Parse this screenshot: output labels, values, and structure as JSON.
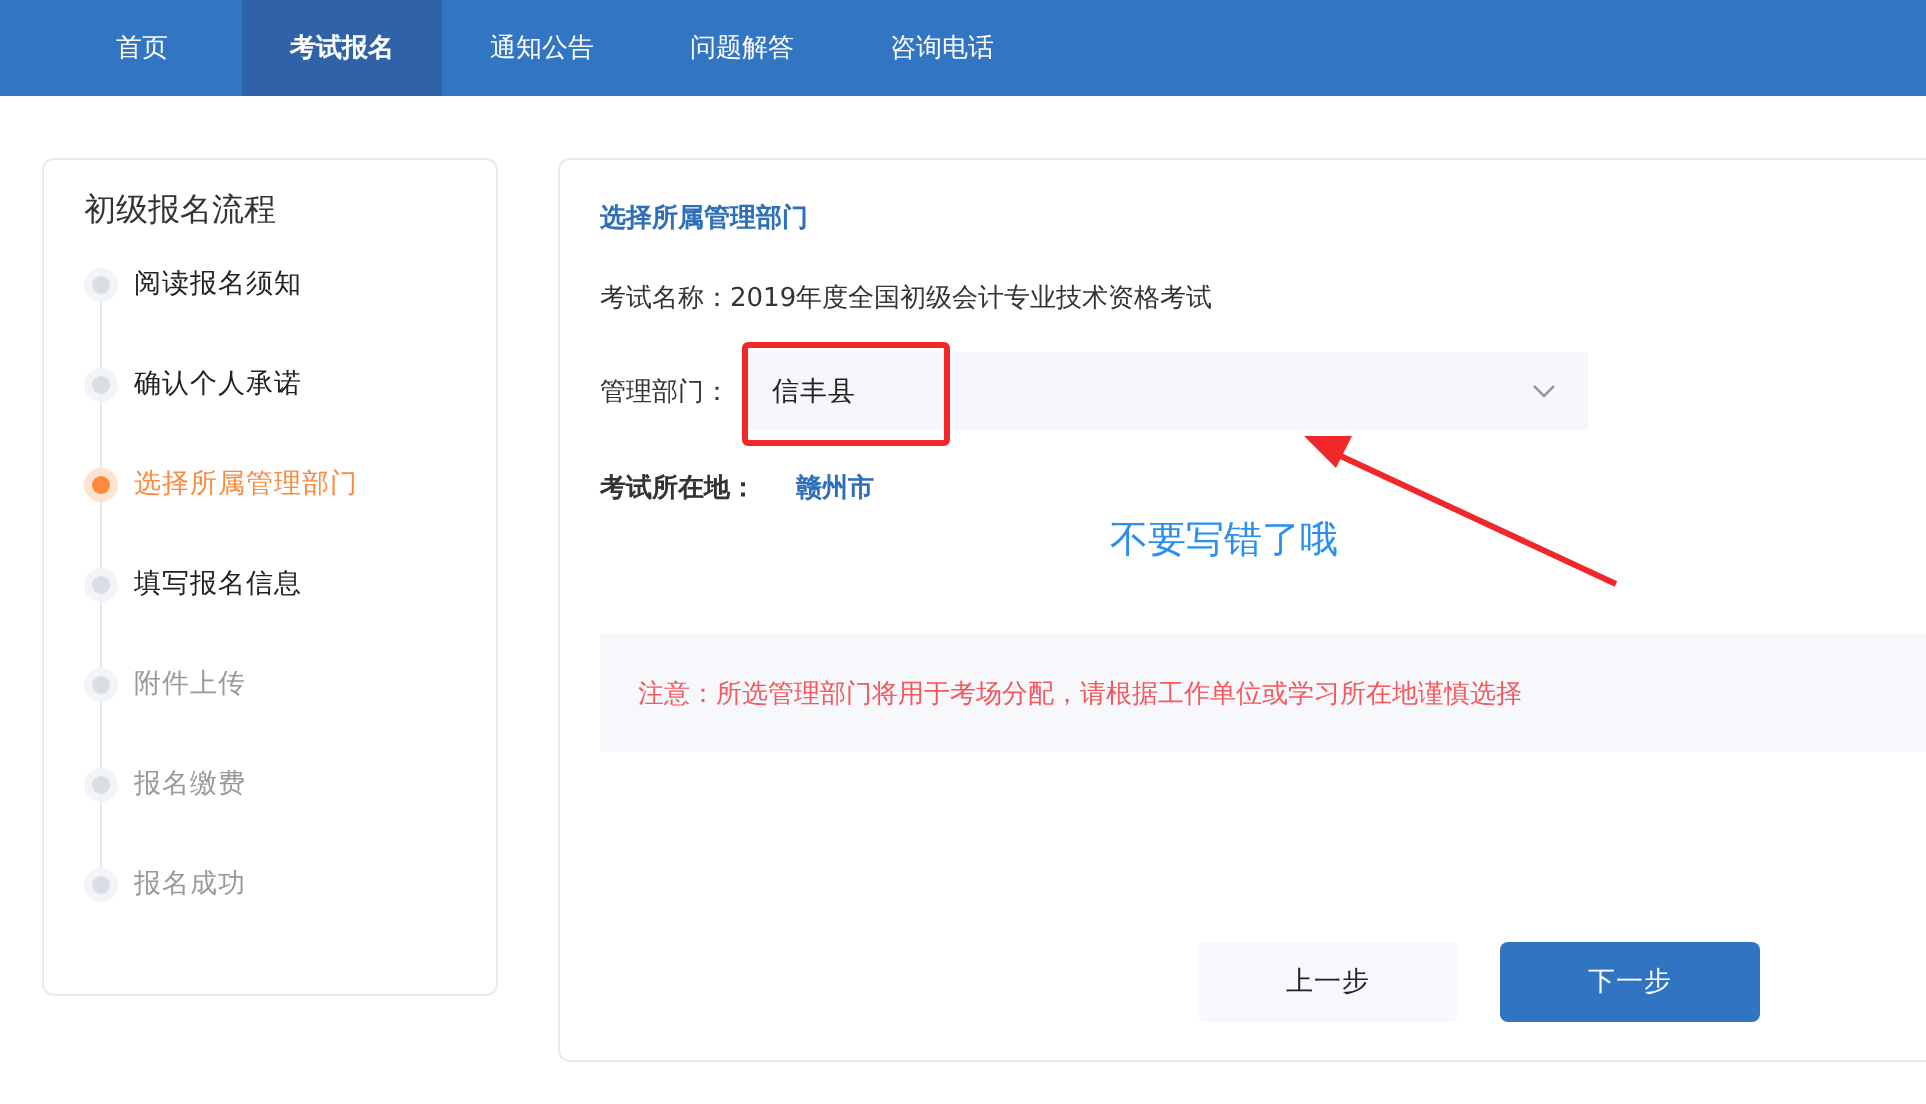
{
  "nav": {
    "tabs": [
      {
        "label": "首页",
        "selected": false
      },
      {
        "label": "考试报名",
        "selected": true
      },
      {
        "label": "通知公告",
        "selected": false
      },
      {
        "label": "问题解答",
        "selected": false
      },
      {
        "label": "咨询电话",
        "selected": false
      }
    ]
  },
  "sidebar": {
    "title": "初级报名流程",
    "steps": [
      {
        "label": "阅读报名须知",
        "selected": false,
        "enabled": true
      },
      {
        "label": "确认个人承诺",
        "selected": false,
        "enabled": true
      },
      {
        "label": "选择所属管理部门",
        "selected": true,
        "enabled": true
      },
      {
        "label": "填写报名信息",
        "selected": false,
        "enabled": true
      },
      {
        "label": "附件上传",
        "selected": false,
        "enabled": false
      },
      {
        "label": "报名缴费",
        "selected": false,
        "enabled": false
      },
      {
        "label": "报名成功",
        "selected": false,
        "enabled": false
      }
    ]
  },
  "form": {
    "heading": "选择所属管理部门",
    "exam_name": "考试名称：2019年度全国初级会计专业技术资格考试",
    "department_label": "管理部门：",
    "department_value": "信丰县",
    "location_label": "考试所在地：",
    "location_value": "赣州市",
    "notice": "注意：所选管理部门将用于考场分配，请根据工作单位或学习所在地谨慎选择",
    "buttons": [
      {
        "label": "上一步",
        "kind": "secondary"
      },
      {
        "label": "下一步",
        "kind": "primary"
      }
    ]
  },
  "annotation": {
    "text": "不要写错了哦"
  }
}
